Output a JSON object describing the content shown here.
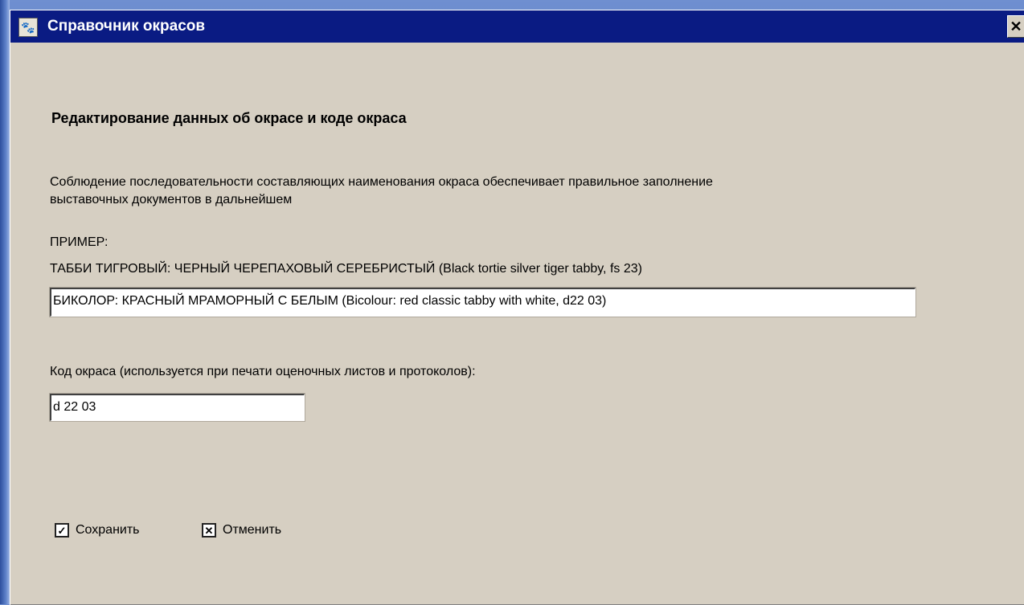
{
  "window": {
    "title": "Справочник окрасов",
    "close_glyph": "✕"
  },
  "form": {
    "heading": "Редактирование данных  об окрасе и коде окраса",
    "description": "Соблюдение последовательности составляющих наименования окраса обеспечивает правильное заполнение выставочных документов в дальнейшем",
    "example_label": "ПРИМЕР:",
    "example_text": "ТАББИ ТИГРОВЫЙ: ЧЕРНЫЙ ЧЕРЕПАХОВЫЙ СЕРЕБРИСТЫЙ (Black tortie silver tiger tabby, fs 23)",
    "color_name_value": "БИКОЛОР: КРАСНЫЙ МРАМОРНЫЙ С БЕЛЫМ (Bicolour: red classic tabby with white, d22 03)",
    "code_label": "Код окраса (используется при печати оценочных листов и протоколов):",
    "code_value": "d 22 03"
  },
  "buttons": {
    "save_label": "Сохранить",
    "save_icon": "checkmark-icon",
    "save_glyph": "✓",
    "cancel_label": "Отменить",
    "cancel_icon": "x-mark-icon",
    "cancel_glyph": "✕"
  },
  "colors": {
    "titlebar": "#0a1b83",
    "window_bg": "#d6cfc2",
    "desktop": "#3e62b8"
  }
}
